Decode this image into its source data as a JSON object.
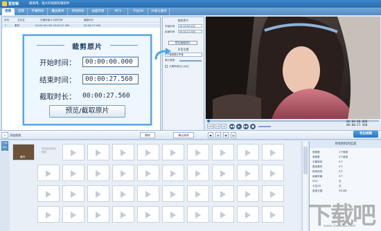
{
  "window": {
    "app_name": "爱剪辑",
    "slogan": "最易用、强大的视频剪辑软件"
  },
  "tabs": [
    {
      "label": "视频",
      "active": true
    },
    {
      "label": "音频",
      "active": false
    },
    {
      "label": "字幕特效",
      "active": false
    },
    {
      "label": "叠加素材",
      "active": false
    },
    {
      "label": "转场特效",
      "active": false
    },
    {
      "label": "画面风格",
      "active": false
    },
    {
      "label": "MTV",
      "active": false
    },
    {
      "label": "卡拉OK",
      "active": false
    },
    {
      "label": "升级与服务",
      "active": false
    }
  ],
  "clip_list": {
    "columns": [
      "序号",
      "文件名",
      "在最终影片中的时间",
      "截取时长"
    ],
    "row": {
      "index": "1",
      "file": "素材",
      "times": "00:00:00.000  00:00:27.560",
      "duration": "00:00:27.560"
    }
  },
  "crop_dialog": {
    "title": "裁剪原片",
    "start_label": "开始时间：",
    "start_value": "00:00:00.000",
    "end_label": "结束时间：",
    "end_value": "00:00:27.560",
    "duration_label": "截取时长：",
    "duration_value": "00:00:27.560",
    "preview_button": "预览/截取原片"
  },
  "side_panel": {
    "header": "裁剪原片",
    "start_label": "开始时间",
    "start_value": "00:00:00.000",
    "end_label": "结束时间",
    "end_value": "00:00:27.560",
    "preview_button": "预览/截取原片",
    "audio_header": "声音设置",
    "audio_option": "不使用原片声音",
    "volume_label": "原片音量",
    "checkbox_label": "头尾声音淡入淡出"
  },
  "player": {
    "current_time": "00:00:00.000",
    "total_time": "00:00:27.560",
    "speed_labels": [
      "20X",
      "1X",
      "2X"
    ]
  },
  "toolbar": {
    "add_video": "添加视频",
    "delete": "删除",
    "confirm": "确认修改",
    "export": "导出视频"
  },
  "storyboard": {
    "side_label": "已添加片段",
    "first_clip": "素材",
    "hint": "双击此处添加视频"
  },
  "info_panel": {
    "header": "所有制作的信息",
    "rows": [
      {
        "label": "视频数",
        "value": "1个视频"
      },
      {
        "label": "音频数",
        "value": "0个音频"
      },
      {
        "label": "字幕特效",
        "value": "0个"
      },
      {
        "label": "叠加素材",
        "value": "0个"
      },
      {
        "label": "转场特效",
        "value": "0个"
      },
      {
        "label": "画面风格",
        "value": "0个"
      },
      {
        "label": "MTV",
        "value": "无"
      },
      {
        "label": "卡拉OK",
        "value": "无"
      },
      {
        "label": "音频长度",
        "value": "0分0秒"
      }
    ]
  },
  "watermark": {
    "main": "下载吧",
    "sub": "www.xiazaiba.com"
  }
}
